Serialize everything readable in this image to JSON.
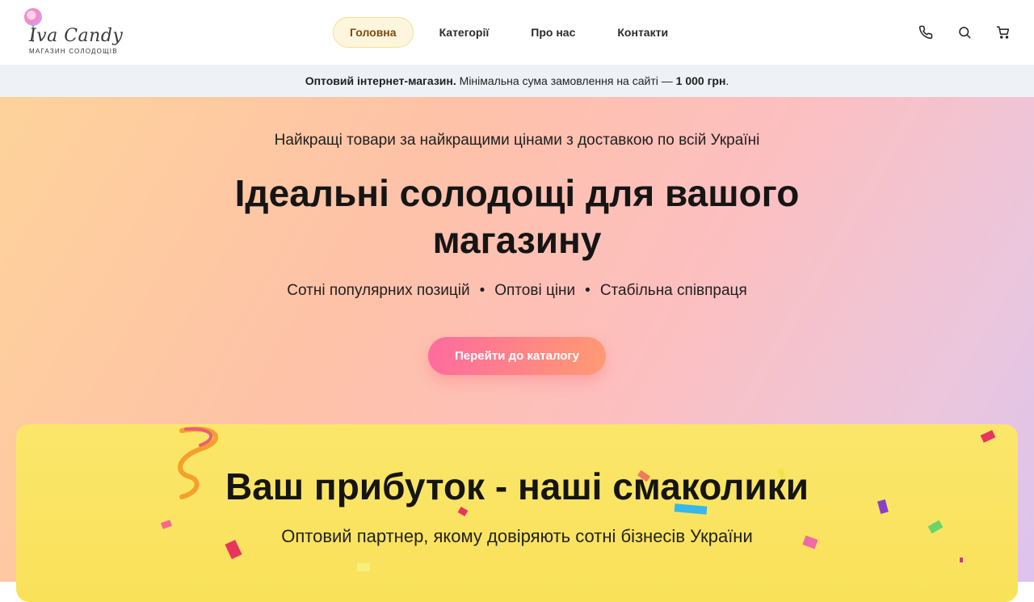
{
  "brand": {
    "logo_text": "Iva Candy",
    "logo_subtitle": "МАГАЗИН СОЛОДОЩІВ"
  },
  "nav": {
    "items": [
      {
        "label": "Головна",
        "active": true
      },
      {
        "label": "Категорії"
      },
      {
        "label": "Про нас"
      },
      {
        "label": "Контакти"
      }
    ]
  },
  "header_icons": [
    "phone-icon",
    "search-icon",
    "cart-icon"
  ],
  "notice": {
    "bold": "Оптовий інтернет-магазин.",
    "text": " Мінімальна сума замовлення на сайті — ",
    "amount": "1 000 грн",
    "end": "."
  },
  "hero": {
    "subtitle": "Найкращі товари за найкращими цінами з доставкою по всій Україні",
    "title": "Ідеальні солодощі для вашого магазину",
    "points": [
      "Сотні популярних позицій",
      "Оптові ціни",
      "Стабільна співпраця"
    ],
    "separator": "•",
    "cta": "Перейти до каталогу"
  },
  "promo": {
    "title": "Ваш прибуток - наші смаколики",
    "subtitle": "Оптовий партнер, якому довіряють сотні бізнесів України"
  },
  "colors": {
    "accent_pink": "#ff6b9e",
    "accent_orange": "#ff9a73",
    "card_yellow": "#fbe66a",
    "nav_active_bg": "#fdf6dc"
  }
}
